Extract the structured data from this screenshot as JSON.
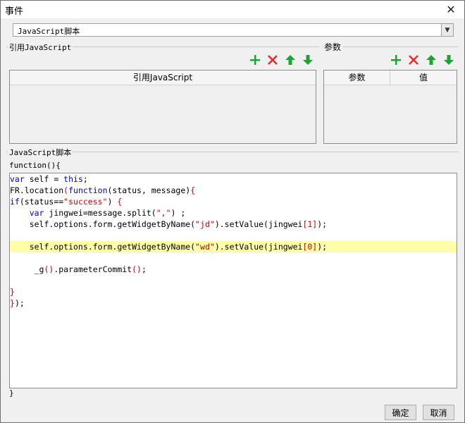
{
  "window": {
    "title": "事件",
    "close_icon": "close-icon"
  },
  "script_type": {
    "selected": "JavaScript脚本"
  },
  "ref_js": {
    "group_label": "引用JavaScript",
    "column_header": "引用JavaScript"
  },
  "params": {
    "group_label": "参数",
    "columns": [
      "参数",
      "值"
    ]
  },
  "toolbar_icons": {
    "add": "add-icon",
    "delete": "delete-icon",
    "up": "arrow-up-icon",
    "down": "arrow-down-icon"
  },
  "script": {
    "group_label": "JavaScript脚本",
    "header": "function(){",
    "footer": "}",
    "lines": [
      [
        {
          "t": "var",
          "c": "k"
        },
        {
          "t": " self = ",
          "c": "plain"
        },
        {
          "t": "this",
          "c": "k"
        },
        {
          "t": ";",
          "c": "plain"
        }
      ],
      [
        {
          "t": "FR.location",
          "c": "plain"
        },
        {
          "t": "(",
          "c": "p"
        },
        {
          "t": "function",
          "c": "k"
        },
        {
          "t": "(status, message)",
          "c": "plain"
        },
        {
          "t": "{",
          "c": "p"
        }
      ],
      [
        {
          "t": "if",
          "c": "k"
        },
        {
          "t": "(status==",
          "c": "plain"
        },
        {
          "t": "\"success\"",
          "c": "s"
        },
        {
          "t": ") ",
          "c": "plain"
        },
        {
          "t": "{",
          "c": "p"
        }
      ],
      [
        {
          "t": "    ",
          "c": "plain"
        },
        {
          "t": "var",
          "c": "k"
        },
        {
          "t": " jingwei=message.split(",
          "c": "plain"
        },
        {
          "t": "\",\"",
          "c": "s"
        },
        {
          "t": ") ;",
          "c": "plain"
        }
      ],
      [
        {
          "t": "    self.options.form.getWidgetByName(",
          "c": "plain"
        },
        {
          "t": "\"jd\"",
          "c": "s"
        },
        {
          "t": ").setValue(jingwei",
          "c": "plain"
        },
        {
          "t": "[1]",
          "c": "p"
        },
        {
          "t": ");",
          "c": "plain"
        }
      ],
      [],
      [
        {
          "t": "    self.options.form.getWidgetByName(",
          "c": "plain"
        },
        {
          "t": "\"wd\"",
          "c": "s"
        },
        {
          "t": ").setValue(jingwei",
          "c": "plain"
        },
        {
          "t": "[0]",
          "c": "p"
        },
        {
          "t": ");",
          "c": "plain"
        }
      ],
      [],
      [
        {
          "t": "     _g",
          "c": "plain"
        },
        {
          "t": "()",
          "c": "p"
        },
        {
          "t": ".parameterCommit",
          "c": "plain"
        },
        {
          "t": "()",
          "c": "p"
        },
        {
          "t": ";",
          "c": "plain"
        }
      ],
      [],
      [
        {
          "t": "}",
          "c": "p"
        }
      ],
      [
        {
          "t": "}",
          "c": "p"
        },
        {
          "t": ");",
          "c": "plain"
        }
      ]
    ],
    "highlighted_line": 7
  },
  "buttons": {
    "ok": "确定",
    "cancel": "取消"
  },
  "colors": {
    "add": "#1aa531",
    "delete": "#e0302c",
    "arrow": "#1aa531",
    "highlight": "#ffffaa",
    "keyword": "#0000cc",
    "string": "#cc0000"
  }
}
